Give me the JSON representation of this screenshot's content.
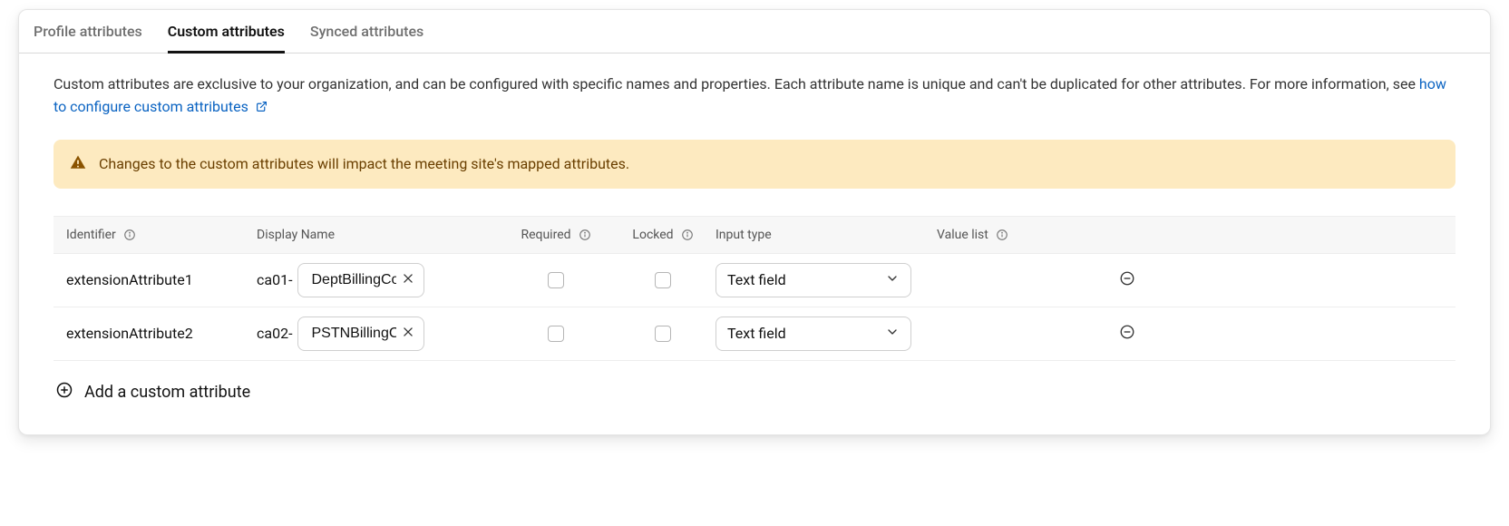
{
  "tabs": {
    "profile": "Profile attributes",
    "custom": "Custom attributes",
    "synced": "Synced attributes"
  },
  "description": {
    "text": "Custom attributes are exclusive to your organization, and can be configured with specific names and properties. Each attribute name is unique and can't be duplicated for other attributes. For more information, see ",
    "link": "how to configure custom attributes"
  },
  "alert": {
    "text": "Changes to the custom attributes will impact the meeting site's mapped attributes."
  },
  "headers": {
    "identifier": "Identifier",
    "displayName": "Display Name",
    "required": "Required",
    "locked": "Locked",
    "inputType": "Input type",
    "valueList": "Value list"
  },
  "rows": [
    {
      "identifier": "extensionAttribute1",
      "prefix": "ca01-",
      "name": "DeptBillingCode",
      "inputType": "Text field"
    },
    {
      "identifier": "extensionAttribute2",
      "prefix": "ca02-",
      "name": "PSTNBillingCode",
      "inputType": "Text field"
    }
  ],
  "addLabel": "Add a custom attribute"
}
